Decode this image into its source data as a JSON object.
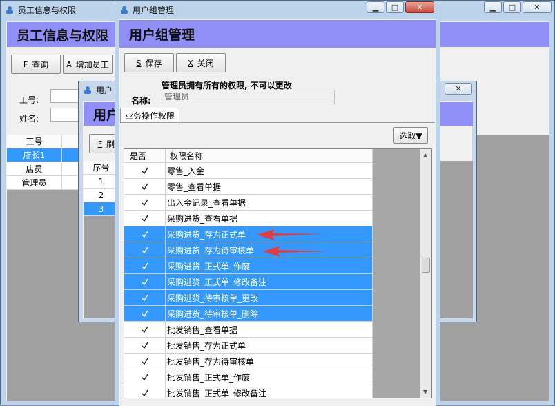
{
  "colors": {
    "accent_bar": "#8f8ff7",
    "selection": "#3399ff",
    "annotation_arrow": "#e53b3b"
  },
  "main_window": {
    "title": "员工信息与权限",
    "banner": "员工信息与权限",
    "toolbar": [
      {
        "hotkey": "F",
        "label": "查询"
      },
      {
        "hotkey": "A",
        "label": "增加员工"
      }
    ],
    "fields": {
      "id_label": "工号:",
      "name_label": "姓名:"
    },
    "table": {
      "headers": [
        "工号"
      ],
      "rows": [
        "店长1",
        "店员",
        "管理员"
      ]
    }
  },
  "middle_window": {
    "title": "用户",
    "banner": "用户",
    "toolbar_hotkey": "F",
    "toolbar_label": "刷",
    "table_header": "序号",
    "rows": [
      "1",
      "2",
      "3"
    ]
  },
  "dialog": {
    "title": "用户组管理",
    "banner": "用户组管理",
    "buttons": [
      {
        "hotkey": "S",
        "label": "保存"
      },
      {
        "hotkey": "X",
        "label": "关闭"
      }
    ],
    "notice": "管理员拥有所有的权限, 不可以更改",
    "name_label": "名称:",
    "name_value": "管理员",
    "tab": "业务操作权限",
    "select_button": "选取▼",
    "grid": {
      "col_check": "是否",
      "col_name": "权限名称",
      "rows": [
        {
          "name": "零售_入金",
          "checked": true,
          "selected": false
        },
        {
          "name": "零售_查看单据",
          "checked": true,
          "selected": false
        },
        {
          "name": "出入金记录_查看单据",
          "checked": true,
          "selected": false
        },
        {
          "name": "采购进货_查看单据",
          "checked": true,
          "selected": false
        },
        {
          "name": "采购进货_存为正式单",
          "checked": true,
          "selected": true
        },
        {
          "name": "采购进货_存为待审核单",
          "checked": true,
          "selected": true
        },
        {
          "name": "采购进货_正式单_作废",
          "checked": true,
          "selected": true
        },
        {
          "name": "采购进货_正式单_修改备注",
          "checked": true,
          "selected": true
        },
        {
          "name": "采购进货_待审核单_更改",
          "checked": true,
          "selected": true
        },
        {
          "name": "采购进货_待审核单_删除",
          "checked": true,
          "selected": true
        },
        {
          "name": "批发销售_查看单据",
          "checked": true,
          "selected": false
        },
        {
          "name": "批发销售_存为正式单",
          "checked": true,
          "selected": false
        },
        {
          "name": "批发销售_存为待审核单",
          "checked": true,
          "selected": false
        },
        {
          "name": "批发销售_正式单_作废",
          "checked": true,
          "selected": false
        },
        {
          "name": "批发销售_正式单_修改备注",
          "checked": true,
          "selected": false
        }
      ]
    }
  }
}
